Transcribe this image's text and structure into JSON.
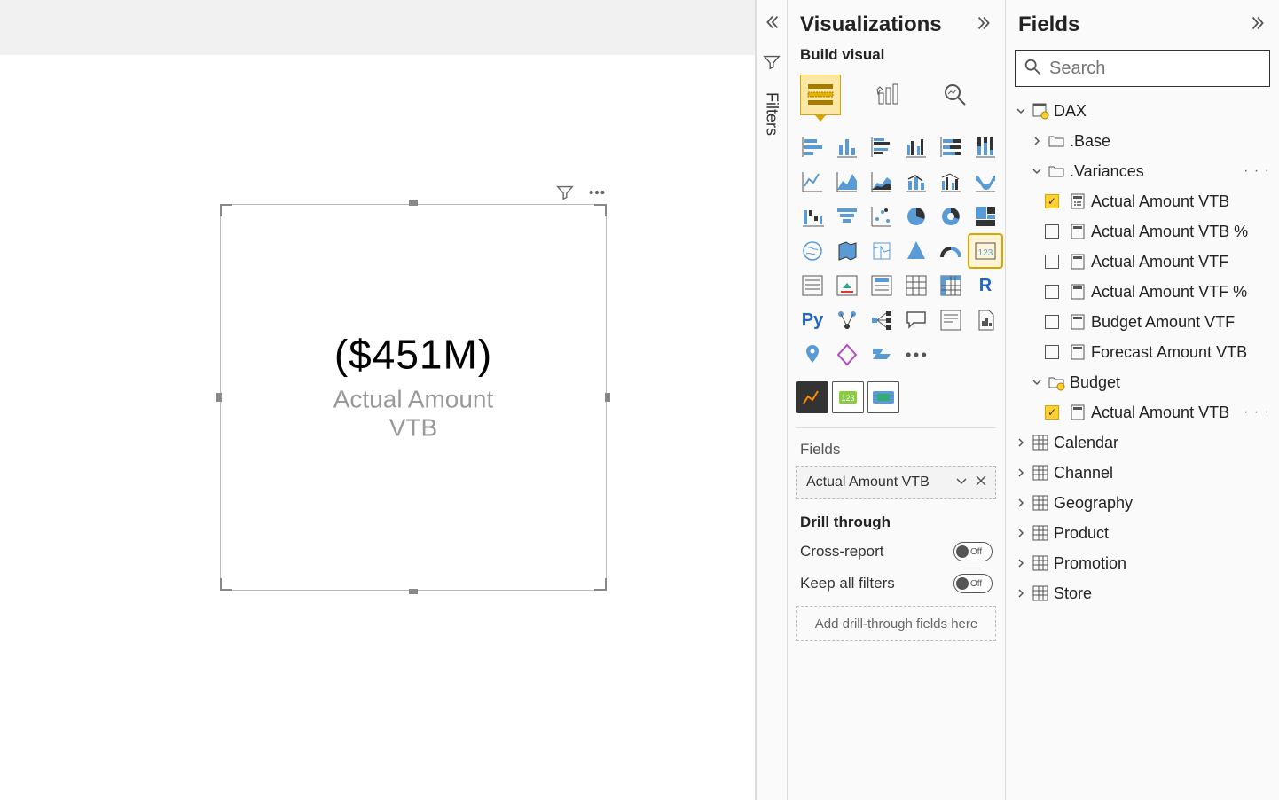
{
  "filters": {
    "label": "Filters"
  },
  "card": {
    "value": "($451M)",
    "label": "Actual Amount VTB"
  },
  "viz_pane": {
    "title": "Visualizations",
    "build_label": "Build visual",
    "fields_label": "Fields",
    "field_pill": "Actual Amount VTB",
    "drill_label": "Drill through",
    "cross_report": "Cross-report",
    "keep_filters": "Keep all filters",
    "toggle_off": "Off",
    "dropzone": "Add drill-through fields here"
  },
  "fields_pane": {
    "title": "Fields",
    "search_placeholder": "Search",
    "tables": {
      "dax": {
        "label": "DAX",
        "expanded": true,
        "folders": {
          "base": {
            "label": ".Base",
            "expanded": false
          },
          "variances": {
            "label": ".Variances",
            "expanded": true,
            "measures": [
              {
                "label": "Actual Amount VTB",
                "checked": true
              },
              {
                "label": "Actual Amount VTB %",
                "checked": false
              },
              {
                "label": "Actual Amount VTF",
                "checked": false
              },
              {
                "label": "Actual Amount VTF %",
                "checked": false
              },
              {
                "label": "Budget Amount VTF",
                "checked": false
              },
              {
                "label": "Forecast Amount VTB",
                "checked": false
              }
            ]
          }
        }
      },
      "budget": {
        "label": "Budget",
        "expanded": true,
        "measures": [
          {
            "label": "Actual Amount VTB",
            "checked": true
          }
        ]
      },
      "others": [
        {
          "label": "Calendar"
        },
        {
          "label": "Channel"
        },
        {
          "label": "Geography"
        },
        {
          "label": "Product"
        },
        {
          "label": "Promotion"
        },
        {
          "label": "Store"
        }
      ]
    }
  }
}
